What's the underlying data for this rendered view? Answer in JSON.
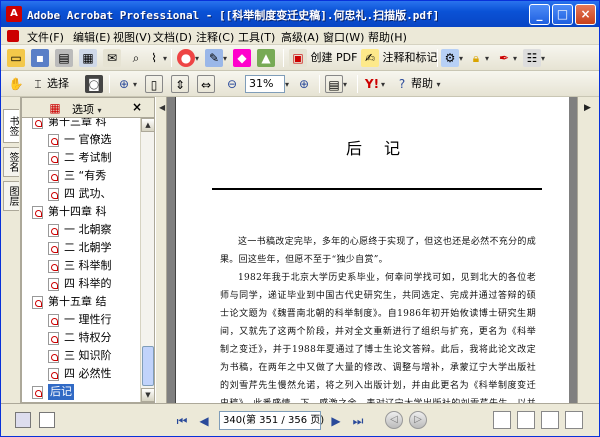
{
  "window": {
    "title": "Adobe Acrobat Professional - [[科举制度变迁史稿].何忠礼.扫描版.pdf]",
    "icon": "acrobat-icon",
    "minimize": "_",
    "maximize": "□",
    "close": "×"
  },
  "menu": {
    "items": [
      "文件(F)",
      "编辑(E)",
      "视图(V)",
      "文档(D)",
      "注释(C)",
      "工具(T)",
      "高级(A)",
      "窗口(W)",
      "帮助(H)"
    ]
  },
  "toolbar1": {
    "create_pdf": "创建 PDF",
    "comment_markup": "注释和标记",
    "dropdown": "▾"
  },
  "toolbar2": {
    "select": "选择",
    "zoom_value": "31%",
    "help": "帮助"
  },
  "side_tabs": [
    "书签",
    "签名",
    "图层"
  ],
  "bookmarks": {
    "options_label": "选项",
    "options_arrow": "▾",
    "close": "×",
    "items": [
      {
        "text": "第十三章 科",
        "level": 0,
        "cut": true
      },
      {
        "text": "一 官僚选",
        "level": 1
      },
      {
        "text": "二 考试制",
        "level": 1
      },
      {
        "text": "三 “有秀",
        "level": 1
      },
      {
        "text": "四 武功、",
        "level": 1
      },
      {
        "text": "第十四章 科",
        "level": 0
      },
      {
        "text": "一 北朝察",
        "level": 1
      },
      {
        "text": "二 北朝学",
        "level": 1
      },
      {
        "text": "三 科举制",
        "level": 1
      },
      {
        "text": "四 科举的",
        "level": 1
      },
      {
        "text": "第十五章 结",
        "level": 0
      },
      {
        "text": "一 理性行",
        "level": 1
      },
      {
        "text": "二 特权分",
        "level": 1
      },
      {
        "text": "三 知识阶",
        "level": 1
      },
      {
        "text": "四 必然性",
        "level": 1
      },
      {
        "text": "后记",
        "level": 0,
        "selected": true
      }
    ]
  },
  "document": {
    "page_title": "后记",
    "paragraphs": [
      "这一书稿改定完毕，多年的心愿终于实现了，但这也还是必然不充分的成果。回这些年，但愿不至于“独少自赏”。",
      "1982年我于北京大学历史系毕业，何幸问学找可如，见到北大的各位老师与同学，递证毕业到中国古代史研究生，共同选定、完成并通过答辩的硕士论文题为《魏晋南北朝的科举制度》。自1986年初开始攸读博士研究生期间，又就先了这两个阶段，并对全文重新进行了组织与扩充，更名为《科举制之变迁》，并于1988年夏通过了博士生论文答辩。此后，我将此论文改定为书稿，在两年之中又做了大量的修改、调整与增补，承蒙辽宁大学出版社的刘雪芹先生慢然允诺，将之列入出版计划，并由此更名为《科举制度变迁史稿》。此番盛情，下，感激之余，表对辽宁大学出版社的刘雪芹先生，以并代"
    ]
  },
  "status": {
    "page_field": "340(第 351 / 356 页)",
    "first": "⏮",
    "prev": "◀",
    "next": "▶",
    "last": "⏭"
  },
  "colors": {
    "titlebar": "#0a52d6",
    "selection": "#316ac5",
    "accent_red": "#cc0000"
  }
}
